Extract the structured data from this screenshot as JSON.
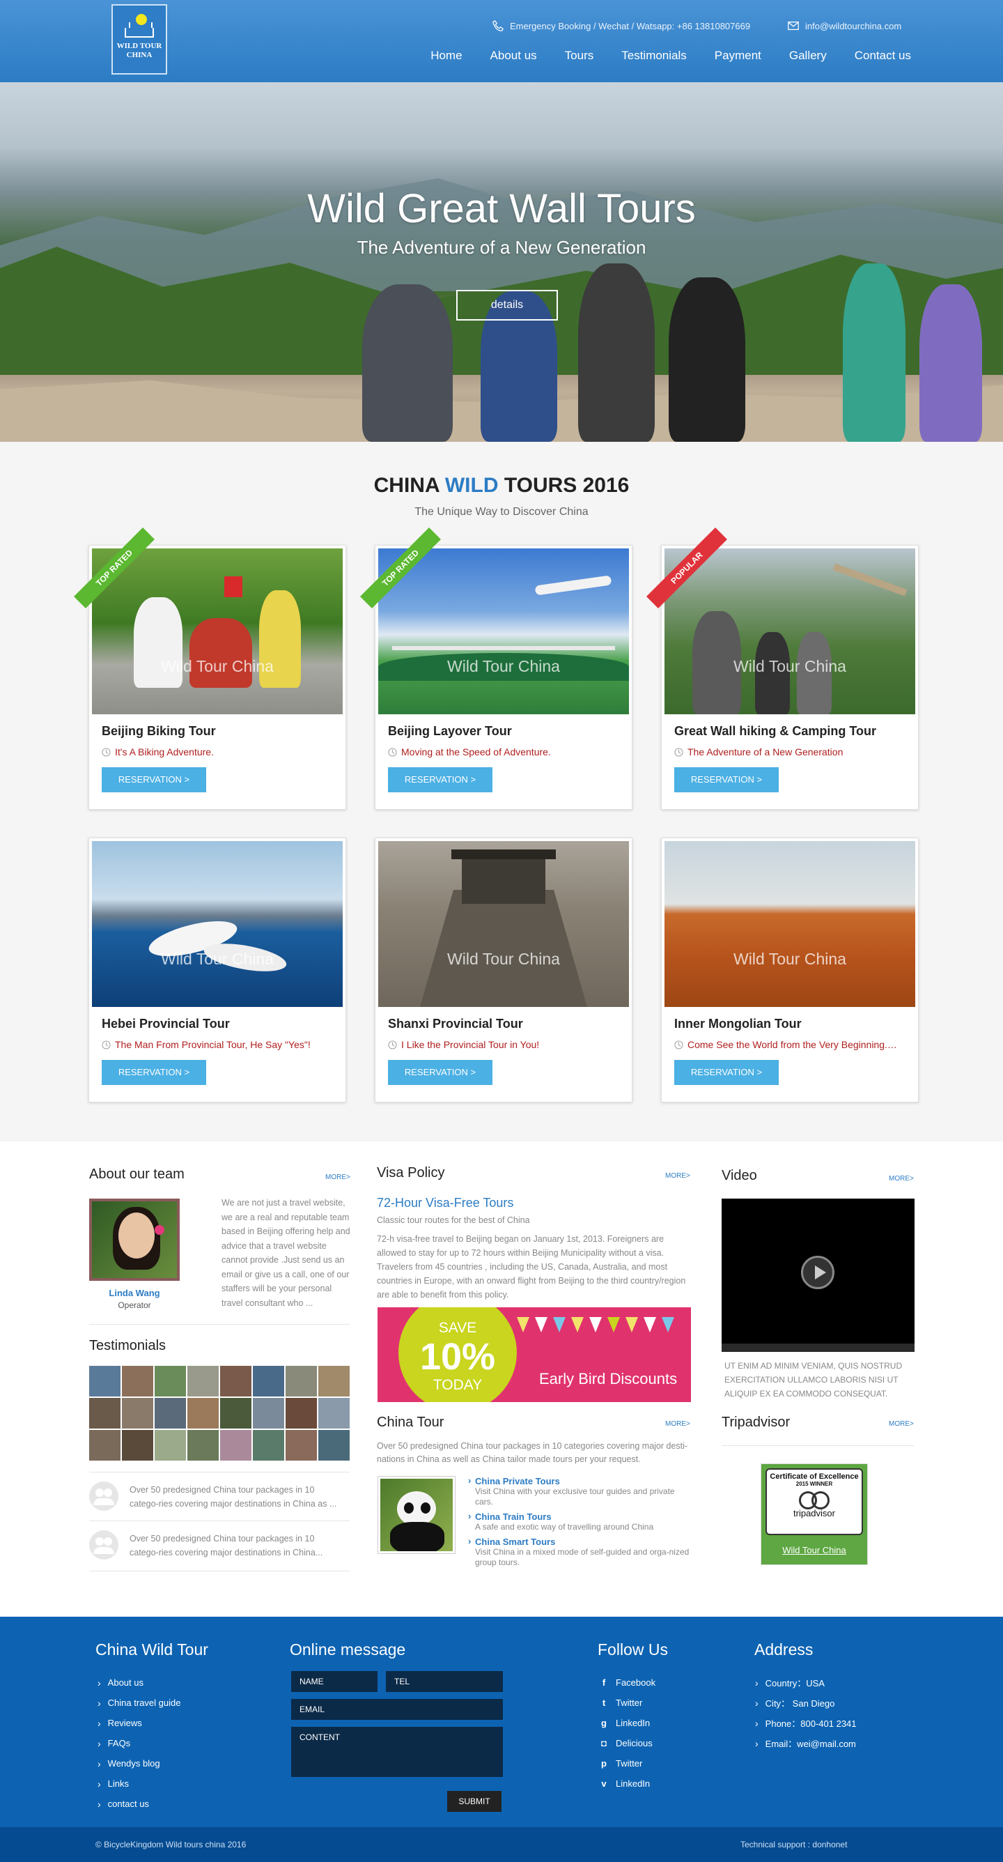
{
  "header": {
    "logo_text_line1": "WILD TOUR",
    "logo_text_line2": "CHINA",
    "phone_text": "Emergency Booking / Wechat / Watsapp: +86 13810807669",
    "email_text": "info@wildtourchina.com",
    "nav": [
      "Home",
      "About us",
      "Tours",
      "Testimonials",
      "Payment",
      "Gallery",
      "Contact us"
    ]
  },
  "hero": {
    "title": "Wild Great Wall Tours",
    "subtitle": "The Adventure of a New Generation",
    "button": "details"
  },
  "tours": {
    "title_before": "CHINA ",
    "title_highlight": "WILD",
    "title_after": " TOURS 2016",
    "subtitle": "The Unique Way to Discover China",
    "watermark": "Wild Tour China",
    "reservation_label": "RESERVATION >",
    "cards": [
      {
        "title": "Beijing Biking Tour",
        "tag": "It's A Biking Adventure.",
        "ribbon": "TOP RATED",
        "ribbon_color": "#5bb830"
      },
      {
        "title": "Beijing Layover Tour",
        "tag": "Moving at the Speed of Adventure.",
        "ribbon": "TOP RATED",
        "ribbon_color": "#5bb830"
      },
      {
        "title": "Great Wall hiking & Camping Tour",
        "tag": "The Adventure of a New Generation",
        "ribbon": "POPULAR",
        "ribbon_color": "#e0323a"
      },
      {
        "title": "Hebei Provincial Tour",
        "tag": "The Man From Provincial Tour, He Say \"Yes\"!",
        "ribbon": "",
        "ribbon_color": ""
      },
      {
        "title": "Shanxi Provincial Tour",
        "tag": "I Like the Provincial Tour in You!",
        "ribbon": "",
        "ribbon_color": ""
      },
      {
        "title": "Inner Mongolian Tour",
        "tag": "Come See the World from the Very Beginning.…",
        "ribbon": "",
        "ribbon_color": ""
      }
    ]
  },
  "about": {
    "heading": "About our team",
    "more": "MORE>",
    "name": "Linda Wang",
    "role": "Operator",
    "text": "We are not just a travel website, we are a real and reputable team based in Beijing offering help and advice that a travel website cannot provide .Just send us an email or give us a call, one of our staffers will be your personal travel consultant who ..."
  },
  "testimonials": {
    "heading": "Testimonials",
    "items": [
      "Over 50 predesigned China tour packages in 10 catego-ries covering major destinations in China as ...",
      "Over 50 predesigned China tour packages in 10 catego-ries covering major destinations in China..."
    ]
  },
  "visa": {
    "heading": "Visa Policy",
    "more": "MORE>",
    "title": "72-Hour Visa-Free Tours",
    "sub": "Classic tour routes for the best of China",
    "text": "72-h visa-free travel to Beijing began on January 1st, 2013. Foreigners are allowed to stay for up to 72 hours within Beijing Municipality without a visa. Travelers from 45 countries , including the US, Canada, Australia, and most countries in Europe, with an onward flight from Beijing to the third country/region are able to benefit from this policy."
  },
  "promo": {
    "save": "SAVE",
    "percent": "10%",
    "today": "TODAY",
    "label": "Early Bird Discounts"
  },
  "china_tour": {
    "heading": "China Tour",
    "more": "MORE>",
    "text": "Over 50 predesigned China tour packages in 10 categories covering major desti-nations in China as well as China tailor made tours per your request.",
    "items": [
      {
        "title": "China Private Tours",
        "desc": "Visit China with your exclusive tour guides and private cars."
      },
      {
        "title": "China Train Tours",
        "desc": "A safe and exotic way of travelling around China"
      },
      {
        "title": "China Smart Tours",
        "desc": "Visit China in a mixed mode of self-guided and orga-nized group tours."
      }
    ]
  },
  "video": {
    "heading": "Video",
    "more": "MORE>",
    "caption": "UT ENIM AD MINIM VENIAM, QUIS NOSTRUD EXERCITATION ULLAMCO LABORIS NISI UT ALIQUIP EX EA COMMODO CONSEQUAT."
  },
  "tripadvisor": {
    "heading": "Tripadvisor",
    "more": "MORE>",
    "badge_line1": "Certificate of Excellence",
    "badge_line2": "2015 WINNER",
    "brand": "tripadvisor",
    "link": "Wild Tour China"
  },
  "footer": {
    "col1_heading": "China Wild Tour",
    "col1_links": [
      "About us",
      "China travel guide",
      "Reviews",
      "FAQs",
      "Wendys blog",
      "Links",
      "contact us"
    ],
    "col2_heading": "Online message",
    "name_placeholder": "NAME",
    "tel_placeholder": "TEL",
    "email_placeholder": "EMAIL",
    "content_placeholder": "CONTENT",
    "submit": "SUBMIT",
    "col3_heading": "Follow Us",
    "follow": [
      {
        "label": "Facebook",
        "icon": "facebook-icon",
        "glyph": "f"
      },
      {
        "label": "Twitter",
        "icon": "twitter-icon",
        "glyph": "t"
      },
      {
        "label": "LinkedIn",
        "icon": "googleplus-icon",
        "glyph": "g"
      },
      {
        "label": "Delicious",
        "icon": "instagram-icon",
        "glyph": "◘"
      },
      {
        "label": "Twitter",
        "icon": "pinterest-icon",
        "glyph": "p"
      },
      {
        "label": "LinkedIn",
        "icon": "vine-icon",
        "glyph": "v"
      }
    ],
    "col4_heading": "Address",
    "address": [
      "Country：USA",
      "City：  San Diego",
      "Phone：800-401 2341",
      "Email：wei@mail.com"
    ],
    "copyright": "© BicycleKingdom Wild tours china 2016",
    "support": "Technical support : donhonet"
  }
}
